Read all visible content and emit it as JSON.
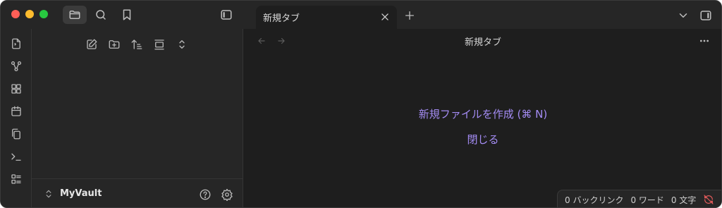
{
  "window": {
    "traffic_lights": {
      "close": "#ff5f57",
      "minimize": "#febc2e",
      "maximize": "#28c840"
    }
  },
  "titlebar": {
    "left_buttons": [
      "folder-icon",
      "search-icon",
      "bookmark-icon"
    ],
    "sidebar_toggle": "sidebar-left-icon",
    "tab": {
      "title": "新規タブ"
    },
    "right_buttons": [
      "chevron-down-icon",
      "sidebar-right-icon"
    ]
  },
  "ribbon": {
    "icons": [
      "file-switcher-icon",
      "graph-icon",
      "canvas-icon",
      "calendar-icon",
      "copy-icon",
      "terminal-icon",
      "list-icon"
    ]
  },
  "sidebar": {
    "tools": [
      "new-note-icon",
      "new-folder-icon",
      "sort-icon",
      "collapse-icon",
      "expand-icon"
    ],
    "vault": {
      "name": "MyVault"
    }
  },
  "main": {
    "title": "新規タブ",
    "create_label": "新規ファイルを作成 (⌘ N)",
    "close_label": "閉じる",
    "accent": "#a48cf4"
  },
  "statusbar": {
    "backlinks": "0 バックリンク",
    "words": "0 ワード",
    "chars": "0 文字",
    "sync_color": "#e05a5a"
  }
}
